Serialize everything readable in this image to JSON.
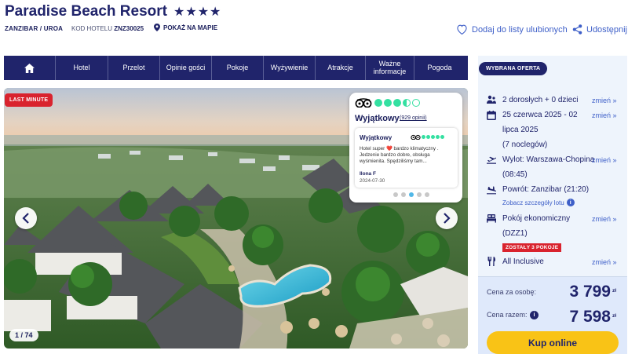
{
  "header": {
    "title": "Paradise Beach Resort",
    "stars": "★★★★",
    "location": "ZANZIBAR / UROA",
    "code_label": "KOD HOTELU",
    "code_value": "ZNZ30025",
    "map_link": "POKAŻ NA MAPIE",
    "favorites_label": "Dodaj do listy ulubionych",
    "share_label": "Udostępnij"
  },
  "nav": {
    "items": [
      "Hotel",
      "Przelot",
      "Opinie gości",
      "Pokoje",
      "Wyżywienie",
      "Atrakcje",
      "Ważne informacje",
      "Pogoda"
    ]
  },
  "gallery": {
    "badge": "LAST MINUTE",
    "counter": "1 / 74"
  },
  "review": {
    "score": 3.5,
    "rating_text": "Wyjątkowy",
    "count_text": "(929 opinii)",
    "card_title": "Wyjątkowy",
    "card_text": "Hotel super ❤️ bardzo klimatyczny . Jedzenie bardzo dobre, obsługa wyśmienita. Spędziliśmy tam...",
    "author": "Ilona F",
    "date": "2024-07-30"
  },
  "offer": {
    "badge": "WYBRANA OFERTA",
    "travelers": "2 dorosłych + 0 dzieci",
    "dates_line1": "25 czerwca 2025 - 02",
    "dates_line2": "lipca 2025",
    "nights": "(7 noclegów)",
    "departure_line1": "Wylot: Warszawa-Chopina",
    "departure_line2": "(08:45)",
    "return": "Powrót: Zanzibar (21:20)",
    "flight_details_link": "Zobacz szczegóły lotu",
    "room_line1": "Pokój ekonomiczny",
    "room_line2": "(DZZ1)",
    "rooms_left": "ZOSTAŁY 3 POKOJE",
    "board": "All Inclusive",
    "change_label": "zmień »"
  },
  "price": {
    "per_person_label": "Cena za osobę:",
    "per_person_value": "3 799",
    "total_label": "Cena razem:",
    "total_value": "7 598",
    "currency": "zł",
    "buy_label": "Kup online"
  },
  "colors": {
    "navy": "#20246b",
    "accent_blue": "#3e5fc8",
    "red": "#d9232e",
    "yellow": "#f9c316",
    "tripadvisor_green": "#34e0a1"
  }
}
